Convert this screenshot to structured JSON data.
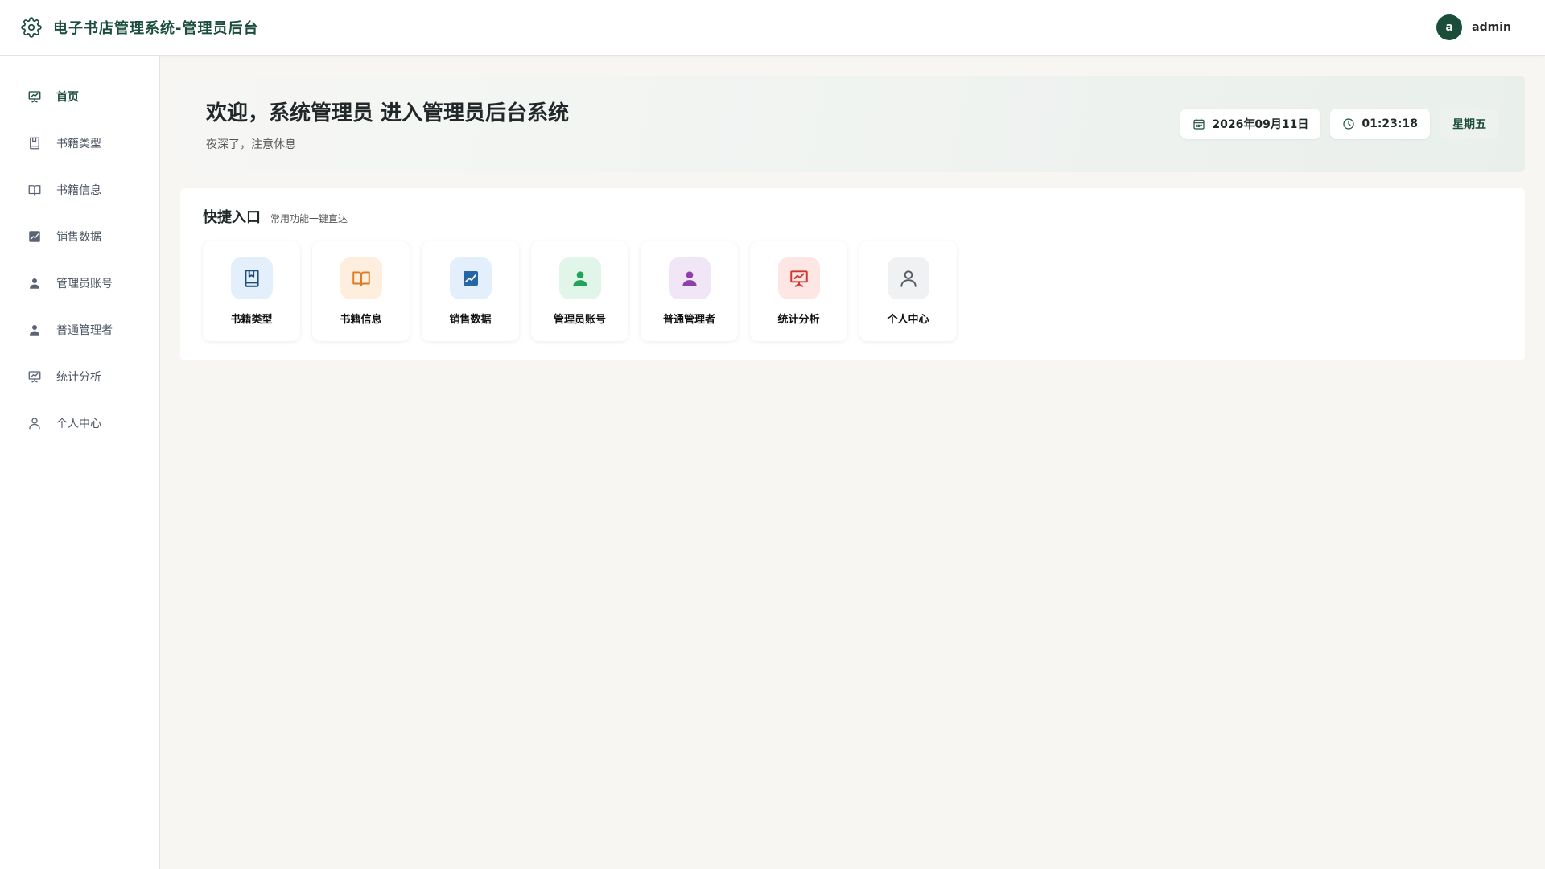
{
  "header": {
    "title": "电子书店管理系统-管理员后台",
    "user": {
      "avatar_letter": "a",
      "name": "admin"
    }
  },
  "sidebar": {
    "items": [
      {
        "label": "首页",
        "icon": "presentation-chart-icon",
        "active": true
      },
      {
        "label": "书籍类型",
        "icon": "bookmark-book-icon"
      },
      {
        "label": "书籍信息",
        "icon": "open-book-icon"
      },
      {
        "label": "销售数据",
        "icon": "line-chart-icon"
      },
      {
        "label": "管理员账号",
        "icon": "user-filled-icon"
      },
      {
        "label": "普通管理者",
        "icon": "user-filled-icon"
      },
      {
        "label": "统计分析",
        "icon": "presentation-chart-icon"
      },
      {
        "label": "个人中心",
        "icon": "user-outline-icon"
      }
    ]
  },
  "welcome": {
    "title": "欢迎，系统管理员 进入管理员后台系统",
    "subtitle": "夜深了，注意休息",
    "date": "2026年09月11日",
    "time": "01:23:18",
    "weekday": "星期五"
  },
  "quick": {
    "title": "快捷入口",
    "subtitle": "常用功能一键直达",
    "cards": [
      {
        "label": "书籍类型",
        "icon": "bookmark-book-icon",
        "bg": "#e3f0fb",
        "color": "#1e4d7a"
      },
      {
        "label": "书籍信息",
        "icon": "open-book-icon",
        "bg": "#fdeedd",
        "color": "#e07b22"
      },
      {
        "label": "销售数据",
        "icon": "line-chart-icon",
        "bg": "#e3f0fb",
        "color": "#2466a6"
      },
      {
        "label": "管理员账号",
        "icon": "user-filled-icon",
        "bg": "#e2f5e9",
        "color": "#22a35a"
      },
      {
        "label": "普通管理者",
        "icon": "user-filled-icon",
        "bg": "#f1e6f5",
        "color": "#8e3fa8"
      },
      {
        "label": "统计分析",
        "icon": "presentation-chart-icon",
        "bg": "#fde6e4",
        "color": "#d1372c"
      },
      {
        "label": "个人中心",
        "icon": "user-outline-icon",
        "bg": "#f0f1f2",
        "color": "#555c66"
      }
    ]
  },
  "colors": {
    "brand": "#1b4d3b",
    "page_bg": "#f8f6f2"
  }
}
